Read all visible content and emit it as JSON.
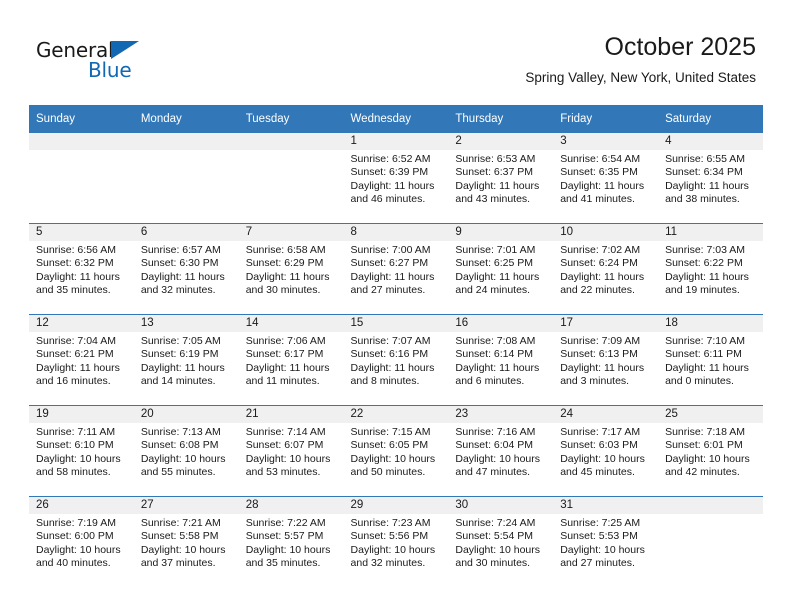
{
  "logo": {
    "primary_text": "General",
    "secondary_text": "Blue",
    "triangle_color": "#1268b3"
  },
  "header": {
    "title": "October 2025",
    "subtitle": "Spring Valley, New York, United States"
  },
  "theme": {
    "header_blue": "#3277b8",
    "daynum_bg": "#f0f0f0",
    "text": "#1a1a1a"
  },
  "weekday_headers": [
    "Sunday",
    "Monday",
    "Tuesday",
    "Wednesday",
    "Thursday",
    "Friday",
    "Saturday"
  ],
  "weeks": [
    [
      {
        "day": "",
        "sunrise": "",
        "sunset": "",
        "daylight_line1": "",
        "daylight_line2": "",
        "empty": true
      },
      {
        "day": "",
        "sunrise": "",
        "sunset": "",
        "daylight_line1": "",
        "daylight_line2": "",
        "empty": true
      },
      {
        "day": "",
        "sunrise": "",
        "sunset": "",
        "daylight_line1": "",
        "daylight_line2": "",
        "empty": true
      },
      {
        "day": "1",
        "sunrise": "Sunrise: 6:52 AM",
        "sunset": "Sunset: 6:39 PM",
        "daylight_line1": "Daylight: 11 hours",
        "daylight_line2": "and 46 minutes.",
        "empty": false
      },
      {
        "day": "2",
        "sunrise": "Sunrise: 6:53 AM",
        "sunset": "Sunset: 6:37 PM",
        "daylight_line1": "Daylight: 11 hours",
        "daylight_line2": "and 43 minutes.",
        "empty": false
      },
      {
        "day": "3",
        "sunrise": "Sunrise: 6:54 AM",
        "sunset": "Sunset: 6:35 PM",
        "daylight_line1": "Daylight: 11 hours",
        "daylight_line2": "and 41 minutes.",
        "empty": false
      },
      {
        "day": "4",
        "sunrise": "Sunrise: 6:55 AM",
        "sunset": "Sunset: 6:34 PM",
        "daylight_line1": "Daylight: 11 hours",
        "daylight_line2": "and 38 minutes.",
        "empty": false
      }
    ],
    [
      {
        "day": "5",
        "sunrise": "Sunrise: 6:56 AM",
        "sunset": "Sunset: 6:32 PM",
        "daylight_line1": "Daylight: 11 hours",
        "daylight_line2": "and 35 minutes.",
        "empty": false
      },
      {
        "day": "6",
        "sunrise": "Sunrise: 6:57 AM",
        "sunset": "Sunset: 6:30 PM",
        "daylight_line1": "Daylight: 11 hours",
        "daylight_line2": "and 32 minutes.",
        "empty": false
      },
      {
        "day": "7",
        "sunrise": "Sunrise: 6:58 AM",
        "sunset": "Sunset: 6:29 PM",
        "daylight_line1": "Daylight: 11 hours",
        "daylight_line2": "and 30 minutes.",
        "empty": false
      },
      {
        "day": "8",
        "sunrise": "Sunrise: 7:00 AM",
        "sunset": "Sunset: 6:27 PM",
        "daylight_line1": "Daylight: 11 hours",
        "daylight_line2": "and 27 minutes.",
        "empty": false
      },
      {
        "day": "9",
        "sunrise": "Sunrise: 7:01 AM",
        "sunset": "Sunset: 6:25 PM",
        "daylight_line1": "Daylight: 11 hours",
        "daylight_line2": "and 24 minutes.",
        "empty": false
      },
      {
        "day": "10",
        "sunrise": "Sunrise: 7:02 AM",
        "sunset": "Sunset: 6:24 PM",
        "daylight_line1": "Daylight: 11 hours",
        "daylight_line2": "and 22 minutes.",
        "empty": false
      },
      {
        "day": "11",
        "sunrise": "Sunrise: 7:03 AM",
        "sunset": "Sunset: 6:22 PM",
        "daylight_line1": "Daylight: 11 hours",
        "daylight_line2": "and 19 minutes.",
        "empty": false
      }
    ],
    [
      {
        "day": "12",
        "sunrise": "Sunrise: 7:04 AM",
        "sunset": "Sunset: 6:21 PM",
        "daylight_line1": "Daylight: 11 hours",
        "daylight_line2": "and 16 minutes.",
        "empty": false
      },
      {
        "day": "13",
        "sunrise": "Sunrise: 7:05 AM",
        "sunset": "Sunset: 6:19 PM",
        "daylight_line1": "Daylight: 11 hours",
        "daylight_line2": "and 14 minutes.",
        "empty": false
      },
      {
        "day": "14",
        "sunrise": "Sunrise: 7:06 AM",
        "sunset": "Sunset: 6:17 PM",
        "daylight_line1": "Daylight: 11 hours",
        "daylight_line2": "and 11 minutes.",
        "empty": false
      },
      {
        "day": "15",
        "sunrise": "Sunrise: 7:07 AM",
        "sunset": "Sunset: 6:16 PM",
        "daylight_line1": "Daylight: 11 hours",
        "daylight_line2": "and 8 minutes.",
        "empty": false
      },
      {
        "day": "16",
        "sunrise": "Sunrise: 7:08 AM",
        "sunset": "Sunset: 6:14 PM",
        "daylight_line1": "Daylight: 11 hours",
        "daylight_line2": "and 6 minutes.",
        "empty": false
      },
      {
        "day": "17",
        "sunrise": "Sunrise: 7:09 AM",
        "sunset": "Sunset: 6:13 PM",
        "daylight_line1": "Daylight: 11 hours",
        "daylight_line2": "and 3 minutes.",
        "empty": false
      },
      {
        "day": "18",
        "sunrise": "Sunrise: 7:10 AM",
        "sunset": "Sunset: 6:11 PM",
        "daylight_line1": "Daylight: 11 hours",
        "daylight_line2": "and 0 minutes.",
        "empty": false
      }
    ],
    [
      {
        "day": "19",
        "sunrise": "Sunrise: 7:11 AM",
        "sunset": "Sunset: 6:10 PM",
        "daylight_line1": "Daylight: 10 hours",
        "daylight_line2": "and 58 minutes.",
        "empty": false
      },
      {
        "day": "20",
        "sunrise": "Sunrise: 7:13 AM",
        "sunset": "Sunset: 6:08 PM",
        "daylight_line1": "Daylight: 10 hours",
        "daylight_line2": "and 55 minutes.",
        "empty": false
      },
      {
        "day": "21",
        "sunrise": "Sunrise: 7:14 AM",
        "sunset": "Sunset: 6:07 PM",
        "daylight_line1": "Daylight: 10 hours",
        "daylight_line2": "and 53 minutes.",
        "empty": false
      },
      {
        "day": "22",
        "sunrise": "Sunrise: 7:15 AM",
        "sunset": "Sunset: 6:05 PM",
        "daylight_line1": "Daylight: 10 hours",
        "daylight_line2": "and 50 minutes.",
        "empty": false
      },
      {
        "day": "23",
        "sunrise": "Sunrise: 7:16 AM",
        "sunset": "Sunset: 6:04 PM",
        "daylight_line1": "Daylight: 10 hours",
        "daylight_line2": "and 47 minutes.",
        "empty": false
      },
      {
        "day": "24",
        "sunrise": "Sunrise: 7:17 AM",
        "sunset": "Sunset: 6:03 PM",
        "daylight_line1": "Daylight: 10 hours",
        "daylight_line2": "and 45 minutes.",
        "empty": false
      },
      {
        "day": "25",
        "sunrise": "Sunrise: 7:18 AM",
        "sunset": "Sunset: 6:01 PM",
        "daylight_line1": "Daylight: 10 hours",
        "daylight_line2": "and 42 minutes.",
        "empty": false
      }
    ],
    [
      {
        "day": "26",
        "sunrise": "Sunrise: 7:19 AM",
        "sunset": "Sunset: 6:00 PM",
        "daylight_line1": "Daylight: 10 hours",
        "daylight_line2": "and 40 minutes.",
        "empty": false
      },
      {
        "day": "27",
        "sunrise": "Sunrise: 7:21 AM",
        "sunset": "Sunset: 5:58 PM",
        "daylight_line1": "Daylight: 10 hours",
        "daylight_line2": "and 37 minutes.",
        "empty": false
      },
      {
        "day": "28",
        "sunrise": "Sunrise: 7:22 AM",
        "sunset": "Sunset: 5:57 PM",
        "daylight_line1": "Daylight: 10 hours",
        "daylight_line2": "and 35 minutes.",
        "empty": false
      },
      {
        "day": "29",
        "sunrise": "Sunrise: 7:23 AM",
        "sunset": "Sunset: 5:56 PM",
        "daylight_line1": "Daylight: 10 hours",
        "daylight_line2": "and 32 minutes.",
        "empty": false
      },
      {
        "day": "30",
        "sunrise": "Sunrise: 7:24 AM",
        "sunset": "Sunset: 5:54 PM",
        "daylight_line1": "Daylight: 10 hours",
        "daylight_line2": "and 30 minutes.",
        "empty": false
      },
      {
        "day": "31",
        "sunrise": "Sunrise: 7:25 AM",
        "sunset": "Sunset: 5:53 PM",
        "daylight_line1": "Daylight: 10 hours",
        "daylight_line2": "and 27 minutes.",
        "empty": false
      },
      {
        "day": "",
        "sunrise": "",
        "sunset": "",
        "daylight_line1": "",
        "daylight_line2": "",
        "empty": true
      }
    ]
  ]
}
